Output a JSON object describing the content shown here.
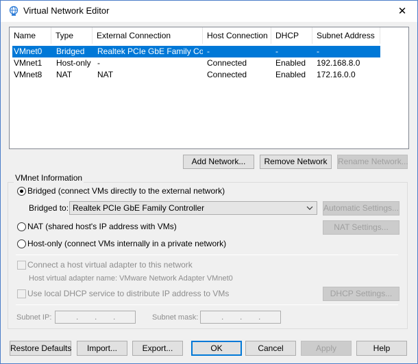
{
  "window": {
    "title": "Virtual Network Editor",
    "icon": "network-globe-icon",
    "close_glyph": "✕",
    "accent_color": "#0078d7"
  },
  "networks": {
    "columns": [
      "Name",
      "Type",
      "External Connection",
      "Host Connection",
      "DHCP",
      "Subnet Address"
    ],
    "rows": [
      {
        "name": "VMnet0",
        "type": "Bridged",
        "external": "Realtek PCIe GbE Family Co...",
        "host": "-",
        "dhcp": "-",
        "subnet": "-",
        "selected": true
      },
      {
        "name": "VMnet1",
        "type": "Host-only",
        "external": "-",
        "host": "Connected",
        "dhcp": "Enabled",
        "subnet": "192.168.8.0",
        "selected": false
      },
      {
        "name": "VMnet8",
        "type": "NAT",
        "external": "NAT",
        "host": "Connected",
        "dhcp": "Enabled",
        "subnet": "172.16.0.0",
        "selected": false
      }
    ]
  },
  "list_buttons": {
    "add": "Add Network...",
    "remove": "Remove Network",
    "rename": "Rename Network..."
  },
  "info": {
    "group_label": "VMnet Information",
    "bridged_label": "Bridged (connect VMs directly to the external network)",
    "bridged_to_label": "Bridged to:",
    "bridged_to_value": "Realtek PCIe GbE Family Controller",
    "automatic_settings": "Automatic Settings...",
    "nat_label": "NAT (shared host's IP address with VMs)",
    "nat_settings": "NAT Settings...",
    "hostonly_label": "Host-only (connect VMs internally in a private network)",
    "connect_adapter_label": "Connect a host virtual adapter to this network",
    "adapter_name_label": "Host virtual adapter name: VMware Network Adapter VMnet0",
    "dhcp_label": "Use local DHCP service to distribute IP address to VMs",
    "dhcp_settings": "DHCP Settings...",
    "subnet_ip_label": "Subnet IP:",
    "subnet_mask_label": "Subnet mask:",
    "ip_dot": "."
  },
  "footer": {
    "restore": "Restore Defaults",
    "import": "Import...",
    "export": "Export...",
    "ok": "OK",
    "cancel": "Cancel",
    "apply": "Apply",
    "help": "Help"
  }
}
